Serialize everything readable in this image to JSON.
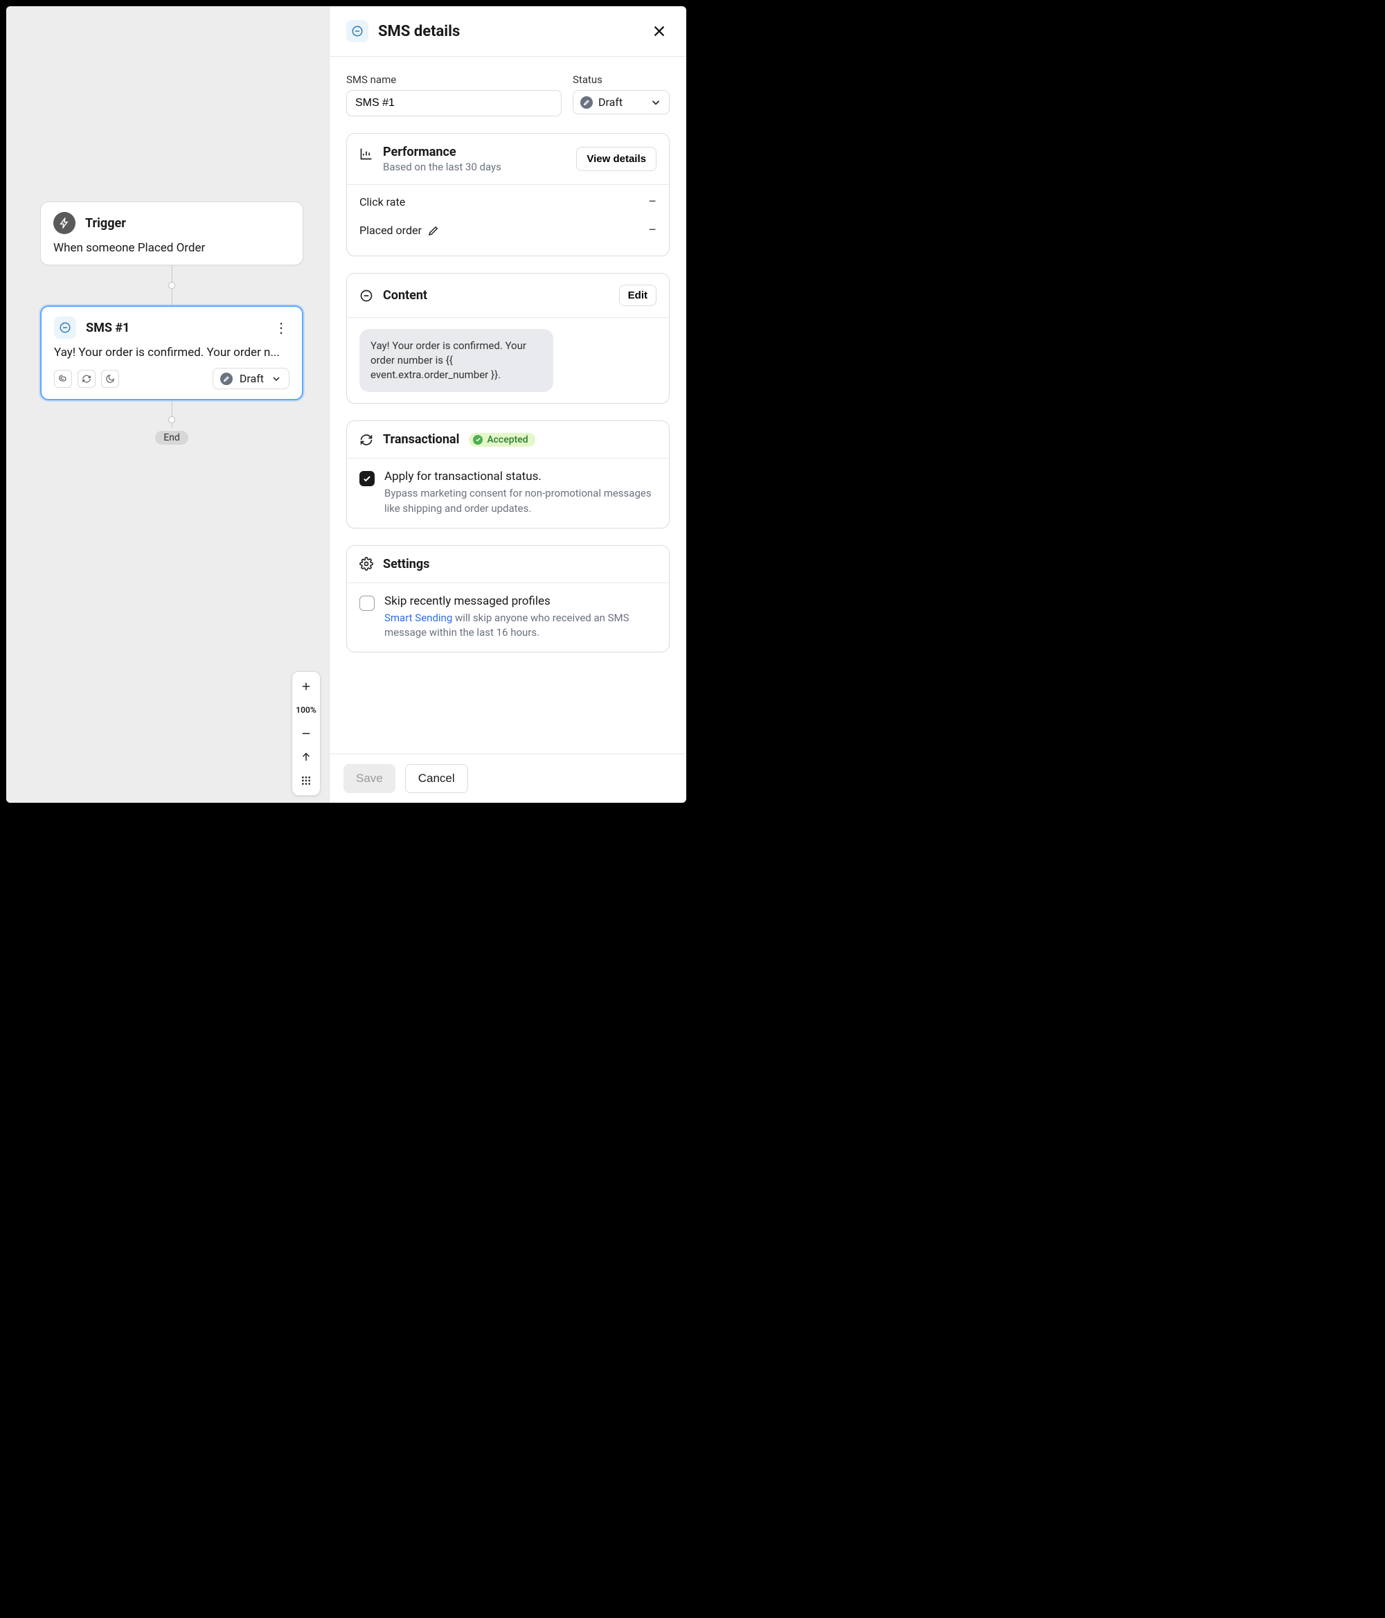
{
  "canvas": {
    "trigger": {
      "title": "Trigger",
      "description": "When someone Placed Order"
    },
    "node": {
      "title": "SMS #1",
      "preview": "Yay! Your order is confirmed. Your order n...",
      "status_label": "Draft"
    },
    "end_label": "End",
    "zoom_label": "100%"
  },
  "panel": {
    "title": "SMS details",
    "fields": {
      "name_label": "SMS name",
      "name_value": "SMS #1",
      "status_label": "Status",
      "status_value": "Draft"
    },
    "performance": {
      "title": "Performance",
      "subtitle": "Based on the last 30 days",
      "view_details": "View details",
      "metrics": [
        {
          "label": "Click rate",
          "value": "–",
          "editable": false
        },
        {
          "label": "Placed order",
          "value": "–",
          "editable": true
        }
      ]
    },
    "content": {
      "title": "Content",
      "edit": "Edit",
      "message": "Yay! Your order is confirmed. Your order number is {{ event.extra.order_number }}."
    },
    "transactional": {
      "title": "Transactional",
      "badge": "Accepted",
      "apply_title": "Apply for transactional status.",
      "apply_desc": "Bypass marketing consent for non-promotional messages like shipping and order updates.",
      "apply_checked": true
    },
    "settings": {
      "title": "Settings",
      "skip": {
        "title": "Skip recently messaged profiles",
        "link": "Smart Sending",
        "desc_rest": " will skip anyone who received an SMS message within the last 16 hours.",
        "checked": false
      }
    },
    "footer": {
      "save": "Save",
      "cancel": "Cancel"
    }
  }
}
